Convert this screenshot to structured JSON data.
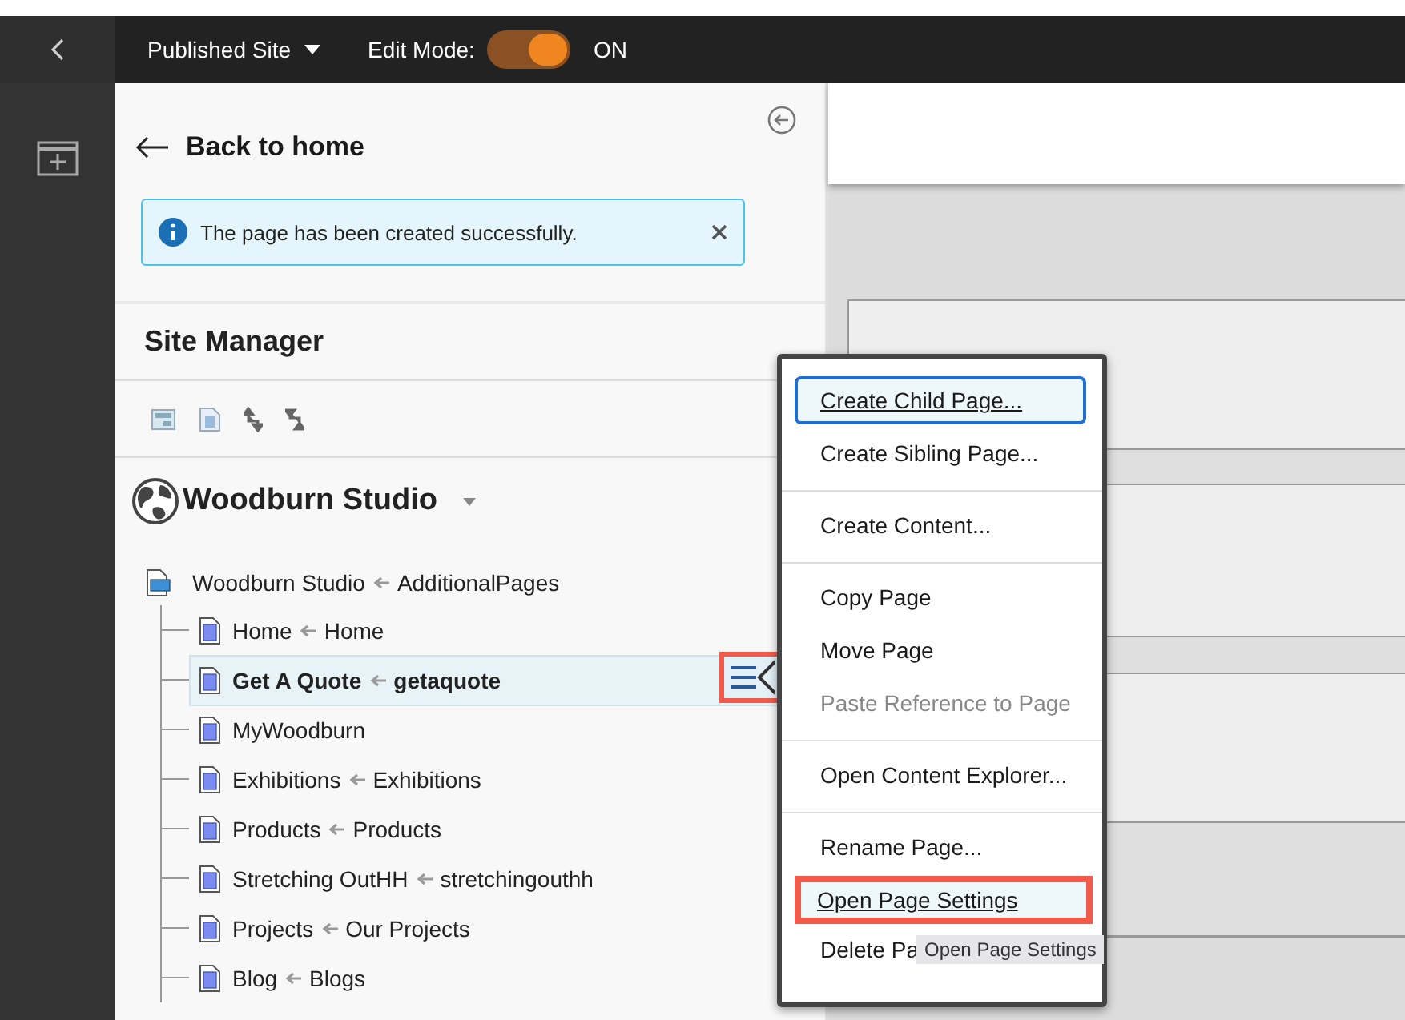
{
  "top_bar": {
    "site_menu": "Published Site",
    "edit_mode": {
      "label": "Edit Mode:",
      "on": true,
      "state_text": "ON"
    }
  },
  "panel": {
    "back_link": "Back to home",
    "alert": "The page has been created successfully.",
    "title": "Site Manager",
    "site_name": "Woodburn Studio",
    "tree": {
      "name": "Woodburn Studio",
      "alias": "AdditionalPages",
      "selected": false,
      "children": [
        {
          "name": "Home",
          "alias": "Home",
          "selected": false
        },
        {
          "name": "Get A Quote",
          "alias": "getaquote",
          "selected": true
        },
        {
          "name": "MyWoodburn",
          "selected": false
        },
        {
          "name": "Exhibitions",
          "alias": "Exhibitions",
          "selected": false
        },
        {
          "name": "Products",
          "alias": "Products",
          "selected": false
        },
        {
          "name": "Stretching OutHH",
          "alias": "stretchingouthh",
          "selected": false
        },
        {
          "name": "Projects",
          "alias": "Our Projects",
          "selected": false
        },
        {
          "name": "Blog",
          "alias": "Blogs",
          "selected": false
        }
      ]
    }
  },
  "context_menu": {
    "groups": [
      [
        {
          "label": "Create Child Page...",
          "focused": true,
          "disabled": false,
          "highlighted": false
        },
        {
          "label": "Create Sibling Page...",
          "focused": false,
          "disabled": false,
          "highlighted": false
        }
      ],
      [
        {
          "label": "Create Content...",
          "focused": false,
          "disabled": false,
          "highlighted": false
        }
      ],
      [
        {
          "label": "Copy Page",
          "focused": false,
          "disabled": false,
          "highlighted": false
        },
        {
          "label": "Move Page",
          "focused": false,
          "disabled": false,
          "highlighted": false
        },
        {
          "label": "Paste Reference to Page",
          "focused": false,
          "disabled": true,
          "highlighted": false
        }
      ],
      [
        {
          "label": "Open Content Explorer...",
          "focused": false,
          "disabled": false,
          "highlighted": false
        }
      ],
      [
        {
          "label": "Rename Page...",
          "focused": false,
          "disabled": false,
          "highlighted": false
        },
        {
          "label": "Open Page Settings",
          "focused": false,
          "disabled": false,
          "highlighted": true
        },
        {
          "label": "Delete Pa",
          "focused": false,
          "disabled": false,
          "highlighted": false
        }
      ]
    ],
    "tooltip": "Open Page Settings"
  }
}
